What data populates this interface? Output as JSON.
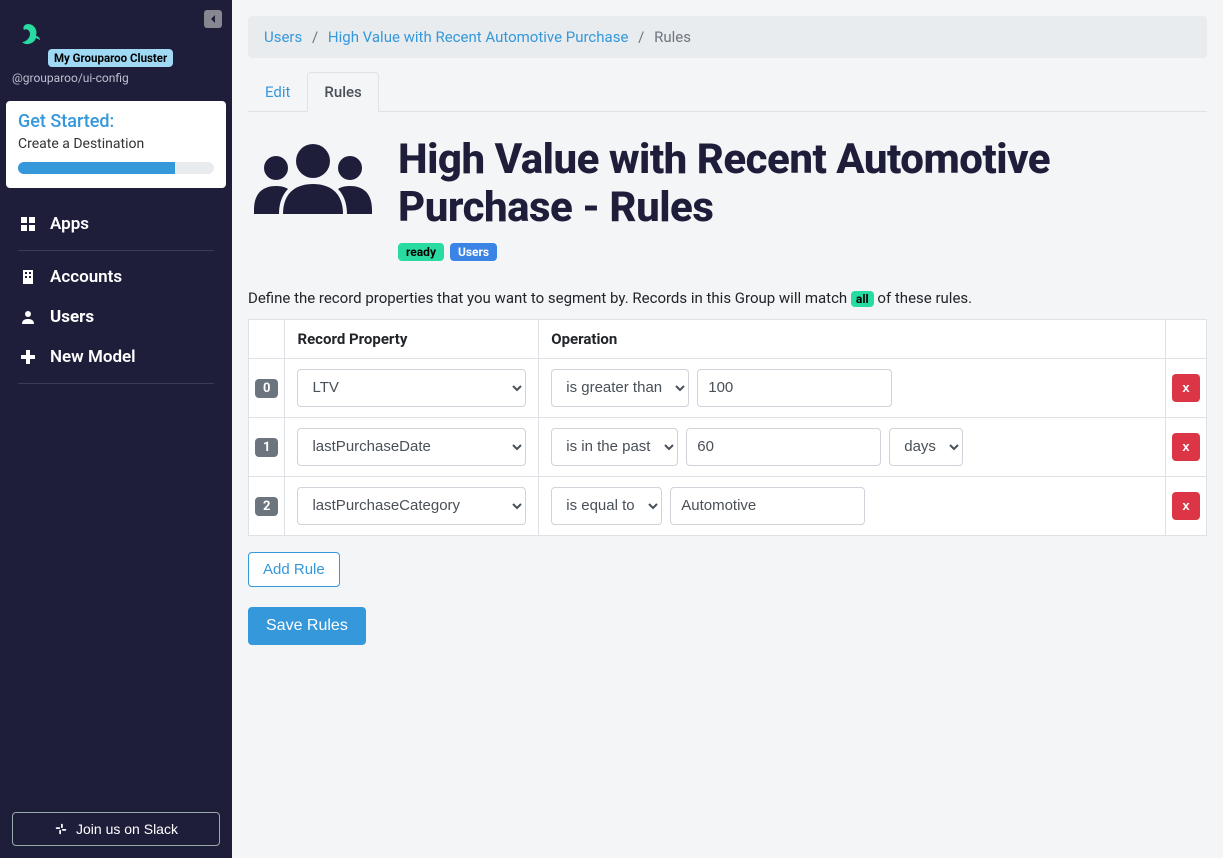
{
  "cluster": {
    "badge": "My Grouparoo Cluster",
    "sub": "@grouparoo/ui-config"
  },
  "get_started": {
    "title": "Get Started:",
    "subtitle": "Create a Destination",
    "progress_pct": 80
  },
  "sidebar": {
    "items": [
      {
        "label": "Apps",
        "icon": "grid"
      },
      {
        "label": "Accounts",
        "icon": "building"
      },
      {
        "label": "Users",
        "icon": "user",
        "active": true
      },
      {
        "label": "New Model",
        "icon": "plus"
      }
    ],
    "slack_label": "Join us on Slack"
  },
  "breadcrumb": {
    "items": [
      {
        "label": "Users",
        "link": true
      },
      {
        "label": "High Value with Recent Automotive Purchase",
        "link": true
      },
      {
        "label": "Rules",
        "link": false
      }
    ]
  },
  "tabs": [
    {
      "label": "Edit",
      "active": false
    },
    {
      "label": "Rules",
      "active": true
    }
  ],
  "page": {
    "title": "High Value with Recent Automotive Purchase - Rules",
    "status_badge": "ready",
    "model_badge": "Users"
  },
  "description": {
    "prefix": "Define the record properties that you want to segment by. Records in this Group will match ",
    "match": "all",
    "suffix": " of these rules."
  },
  "table": {
    "col_property": "Record Property",
    "col_operation": "Operation",
    "rules": [
      {
        "index": "0",
        "property": "LTV",
        "operation": "is greater than",
        "value": "100",
        "unit": null,
        "delete": "x"
      },
      {
        "index": "1",
        "property": "lastPurchaseDate",
        "operation": "is in the past",
        "value": "60",
        "unit": "days",
        "delete": "x"
      },
      {
        "index": "2",
        "property": "lastPurchaseCategory",
        "operation": "is equal to",
        "value": "Automotive",
        "unit": null,
        "delete": "x"
      }
    ]
  },
  "buttons": {
    "add_rule": "Add Rule",
    "save": "Save Rules"
  },
  "colors": {
    "sidebar_bg": "#1e1e3b",
    "accent": "#3498db",
    "danger": "#dc3545",
    "success": "#28dba0"
  }
}
